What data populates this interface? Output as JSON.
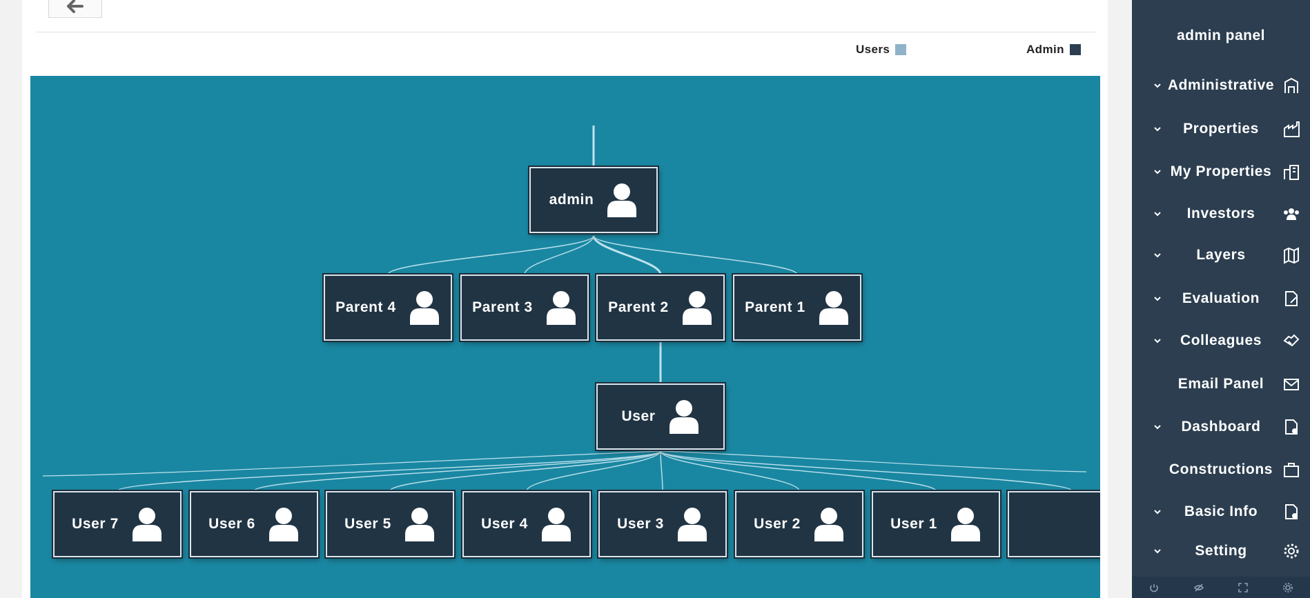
{
  "legend": {
    "users_label": "Users",
    "users_color": "#8fb3c9",
    "admin_label": "Admin",
    "admin_color": "#2c3e50"
  },
  "tree": {
    "root": "admin",
    "parents": [
      "Parent 4",
      "Parent 3",
      "Parent 2",
      "Parent 1"
    ],
    "group": "User",
    "users": [
      "User 7",
      "User 6",
      "User 5",
      "User 4",
      "User 3",
      "User 2",
      "User 1",
      ""
    ]
  },
  "sidebar": {
    "title": "admin panel",
    "items": [
      {
        "label": "Administrative",
        "icon": "building-icon",
        "chevron": true
      },
      {
        "label": "Properties",
        "icon": "factory-icon",
        "chevron": true
      },
      {
        "label": "My Properties",
        "icon": "buildings-icon",
        "chevron": true
      },
      {
        "label": "Investors",
        "icon": "people-icon",
        "chevron": true
      },
      {
        "label": "Layers",
        "icon": "map-icon",
        "chevron": true
      },
      {
        "label": "Evaluation",
        "icon": "file-edit-icon",
        "chevron": true
      },
      {
        "label": "Colleagues",
        "icon": "handshake-icon",
        "chevron": true
      },
      {
        "label": "Email Panel",
        "icon": "envelope-icon",
        "chevron": false
      },
      {
        "label": "Dashboard",
        "icon": "file-chart-icon",
        "chevron": true
      },
      {
        "label": "Constructions",
        "icon": "briefcase-icon",
        "chevron": false
      },
      {
        "label": "Basic Info",
        "icon": "file-info-icon",
        "chevron": true
      },
      {
        "label": "Setting",
        "icon": "gear-icon",
        "chevron": true
      }
    ],
    "footer_icons": [
      "power-icon",
      "eye-off-icon",
      "fullscreen-icon",
      "settings-icon"
    ]
  },
  "colors": {
    "canvas": "#1a87a2",
    "node": "#213444",
    "sidebar": "#2c3e50"
  }
}
